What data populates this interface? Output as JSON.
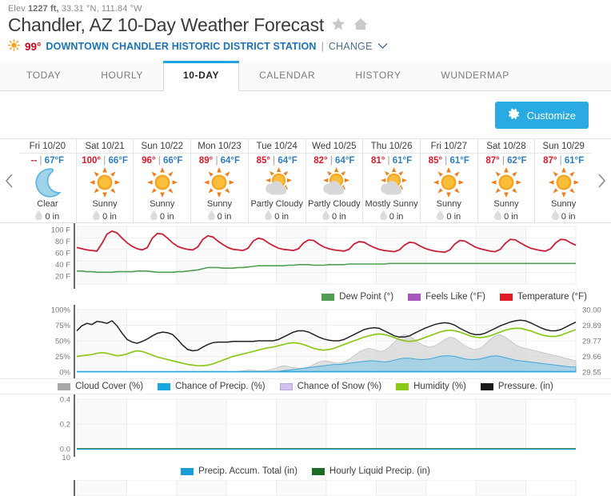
{
  "header": {
    "elev_prefix": "Elev",
    "elev_value": "1227 ft,",
    "coords": "33.31 °N, 111.84 °W",
    "title": "Chandler, AZ 10-Day Weather Forecast",
    "star_icon": "star-icon",
    "home_icon": "home-icon",
    "current_temp": "99°",
    "sun_icon": "sun-icon",
    "station": "DOWNTOWN CHANDLER HISTORIC DISTRICT STATION",
    "pipe": "|",
    "change_label": "CHANGE",
    "chevron_icon": "chevron-down-icon"
  },
  "tabs": [
    {
      "label": "TODAY",
      "active": false
    },
    {
      "label": "HOURLY",
      "active": false
    },
    {
      "label": "10-DAY",
      "active": true
    },
    {
      "label": "CALENDAR",
      "active": false
    },
    {
      "label": "HISTORY",
      "active": false
    },
    {
      "label": "WUNDERMAP",
      "active": false
    }
  ],
  "toolbar": {
    "customize_label": "Customize",
    "gear_icon": "gear-icon",
    "accent_color": "#29aae2"
  },
  "daystrip": {
    "prev_icon": "chevron-left-icon",
    "next_icon": "chevron-right-icon",
    "days": [
      {
        "name": "Fri 10/20",
        "high": "--",
        "low": "67°F",
        "cond": "Clear",
        "icon": "moon-icon",
        "precip": "0 in"
      },
      {
        "name": "Sat 10/21",
        "high": "100°",
        "low": "66°F",
        "cond": "Sunny",
        "icon": "sun-icon",
        "precip": "0 in"
      },
      {
        "name": "Sun 10/22",
        "high": "96°",
        "low": "66°F",
        "cond": "Sunny",
        "icon": "sun-icon",
        "precip": "0 in"
      },
      {
        "name": "Mon 10/23",
        "high": "89°",
        "low": "64°F",
        "cond": "Sunny",
        "icon": "sun-icon",
        "precip": "0 in"
      },
      {
        "name": "Tue 10/24",
        "high": "85°",
        "low": "64°F",
        "cond": "Partly Cloudy",
        "icon": "sun-cloud-icon",
        "precip": "0 in"
      },
      {
        "name": "Wed 10/25",
        "high": "82°",
        "low": "64°F",
        "cond": "Partly Cloudy",
        "icon": "sun-cloud-icon",
        "precip": "0 in"
      },
      {
        "name": "Thu 10/26",
        "high": "81°",
        "low": "61°F",
        "cond": "Mostly Sunny",
        "icon": "sun-cloud-icon",
        "precip": "0 in"
      },
      {
        "name": "Fri 10/27",
        "high": "85°",
        "low": "61°F",
        "cond": "Sunny",
        "icon": "sun-icon",
        "precip": "0 in"
      },
      {
        "name": "Sat 10/28",
        "high": "87°",
        "low": "62°F",
        "cond": "Sunny",
        "icon": "sun-icon",
        "precip": "0 in"
      },
      {
        "name": "Sun 10/29",
        "high": "87°",
        "low": "61°F",
        "cond": "Sunny",
        "icon": "sun-icon",
        "precip": "0 in"
      }
    ],
    "precip_drop_icon": "raindrop-icon"
  },
  "chart_data": [
    {
      "id": "temperature-chart",
      "type": "line",
      "title": "",
      "ylabel": "",
      "ylim": [
        10,
        108
      ],
      "yticks": [
        100,
        80,
        60,
        40,
        20
      ],
      "ytick_labels": [
        "100 F",
        "80 F",
        "60 F",
        "40 F",
        "20 F"
      ],
      "grid": true,
      "legend_position": "bottom-right",
      "x_days": 10,
      "series": [
        {
          "name": "Temperature (°F)",
          "color": "#cc1f37",
          "values": [
            72,
            70,
            68,
            67,
            66,
            79,
            95,
            100,
            97,
            88,
            80,
            74,
            70,
            68,
            72,
            88,
            96,
            95,
            88,
            80,
            74,
            71,
            69,
            68,
            73,
            86,
            92,
            90,
            83,
            77,
            72,
            69,
            68,
            67,
            71,
            83,
            88,
            86,
            80,
            75,
            71,
            69,
            68,
            67,
            70,
            80,
            85,
            84,
            78,
            73,
            70,
            68,
            67,
            66,
            69,
            78,
            82,
            81,
            76,
            72,
            69,
            67,
            66,
            65,
            68,
            76,
            81,
            80,
            75,
            71,
            68,
            66,
            65,
            64,
            68,
            78,
            84,
            83,
            78,
            73,
            70,
            68,
            66,
            65,
            69,
            79,
            86,
            85,
            80,
            75,
            71,
            69,
            67,
            66,
            70,
            80,
            86,
            85,
            80,
            76
          ]
        },
        {
          "name": "Dew Point (°)",
          "color": "#4f9e52",
          "values": [
            32,
            32,
            31,
            31,
            30,
            30,
            30,
            30,
            31,
            31,
            31,
            31,
            32,
            32,
            32,
            31,
            30,
            30,
            30,
            30,
            31,
            31,
            32,
            33,
            34,
            36,
            38,
            38,
            38,
            37,
            37,
            37,
            38,
            38,
            39,
            40,
            41,
            41,
            41,
            41,
            41,
            41,
            42,
            42,
            43,
            43,
            43,
            42,
            42,
            42,
            43,
            43,
            43,
            43,
            44,
            44,
            44,
            44,
            44,
            44,
            44,
            44,
            45,
            45,
            45,
            45,
            45,
            45,
            45,
            45,
            45,
            45,
            45,
            45,
            45,
            45,
            45,
            45,
            45,
            45,
            45,
            45,
            45,
            45,
            45,
            45,
            45,
            45,
            45,
            45,
            45,
            45,
            45,
            45,
            45,
            45,
            45,
            45,
            45,
            45
          ]
        },
        {
          "name": "Feels Like (°F)",
          "color": "#a855c0",
          "values": []
        }
      ]
    },
    {
      "id": "conditions-chart",
      "type": "area-line",
      "ylim_left": [
        0,
        100
      ],
      "yticks_left": [
        100,
        75,
        50,
        25,
        0
      ],
      "ytick_labels_left": [
        "100%",
        "75%",
        "50%",
        "25%",
        "0%"
      ],
      "ylim_right": [
        29.55,
        30.0
      ],
      "yticks_right": [
        30.0,
        29.89,
        29.77,
        29.66,
        29.55
      ],
      "ytick_labels_right": [
        "30.00",
        "29.89",
        "29.77",
        "29.66",
        "29.55"
      ],
      "grid": true,
      "legend_position": "bottom-center",
      "series": [
        {
          "name": "Pressure. (in)",
          "color": "#222222",
          "axis": "right",
          "values": [
            66,
            74,
            78,
            76,
            81,
            80,
            78,
            82,
            74,
            62,
            52,
            48,
            46,
            49,
            53,
            58,
            62,
            64,
            63,
            60,
            52,
            43,
            36,
            34,
            35,
            40,
            44,
            47,
            48,
            48,
            48,
            49,
            49,
            49,
            49,
            49,
            50,
            50,
            50,
            50,
            52,
            56,
            60,
            64,
            66,
            66,
            64,
            60,
            56,
            53,
            51,
            50,
            50,
            52,
            56,
            60,
            64,
            68,
            70,
            71,
            70,
            66,
            62,
            58,
            56,
            56,
            58,
            62,
            66,
            70,
            73,
            76,
            78,
            79,
            78,
            75,
            70,
            66,
            62,
            60,
            60,
            62,
            66,
            70,
            74,
            77,
            80,
            82,
            83,
            82,
            79,
            75,
            71,
            68,
            66,
            66,
            68,
            72,
            76,
            80
          ]
        },
        {
          "name": "Humidity (%)",
          "color": "#8bc919",
          "axis": "left",
          "values": [
            25,
            26,
            27,
            28,
            30,
            31,
            30,
            28,
            26,
            27,
            29,
            32,
            34,
            33,
            30,
            27,
            24,
            22,
            20,
            18,
            16,
            14,
            12,
            11,
            10,
            10,
            11,
            13,
            16,
            19,
            22,
            25,
            27,
            29,
            31,
            33,
            35,
            37,
            39,
            40,
            42,
            44,
            46,
            47,
            46,
            44,
            41,
            38,
            36,
            35,
            36,
            38,
            41,
            44,
            47,
            50,
            53,
            56,
            58,
            60,
            61,
            60,
            58,
            55,
            52,
            50,
            49,
            50,
            52,
            55,
            58,
            61,
            64,
            66,
            67,
            66,
            64,
            61,
            58,
            56,
            55,
            56,
            58,
            61,
            64,
            67,
            69,
            70,
            70,
            68,
            66,
            63,
            60,
            58,
            57,
            57,
            59,
            62,
            65,
            68
          ]
        },
        {
          "name": "Cloud Cover (%)",
          "color": "#b4b4b4",
          "axis": "left",
          "values": [
            0,
            0,
            0,
            0,
            0,
            0,
            0,
            0,
            0,
            0,
            0,
            0,
            0,
            0,
            0,
            0,
            0,
            0,
            0,
            0,
            0,
            0,
            0,
            0,
            0,
            0,
            0,
            0,
            0,
            0,
            0,
            0,
            1,
            2,
            3,
            3,
            2,
            2,
            3,
            5,
            8,
            10,
            9,
            7,
            6,
            6,
            8,
            12,
            16,
            18,
            17,
            15,
            14,
            16,
            20,
            26,
            32,
            36,
            38,
            36,
            33,
            34,
            40,
            48,
            56,
            60,
            58,
            52,
            46,
            42,
            40,
            42,
            46,
            52,
            56,
            54,
            48,
            42,
            38,
            36,
            38,
            44,
            52,
            58,
            60,
            56,
            50,
            44,
            40,
            38,
            36,
            34,
            32,
            30,
            28,
            26,
            24,
            22,
            20,
            18
          ]
        },
        {
          "name": "Chance of Precip. (%)",
          "color": "#29a9dd",
          "axis": "left",
          "values": [
            0,
            0,
            0,
            0,
            0,
            0,
            0,
            0,
            0,
            0,
            0,
            0,
            0,
            0,
            0,
            0,
            0,
            0,
            0,
            0,
            0,
            0,
            0,
            0,
            0,
            0,
            0,
            0,
            0,
            0,
            0,
            0,
            0,
            0,
            0,
            0,
            0,
            0,
            0,
            0,
            1,
            2,
            3,
            4,
            5,
            6,
            7,
            8,
            9,
            10,
            11,
            12,
            12,
            13,
            14,
            15,
            16,
            17,
            18,
            18,
            17,
            16,
            17,
            19,
            21,
            22,
            22,
            21,
            20,
            20,
            21,
            23,
            25,
            26,
            26,
            25,
            23,
            21,
            20,
            20,
            21,
            23,
            25,
            26,
            25,
            23,
            21,
            19,
            18,
            17,
            16,
            15,
            14,
            13,
            12,
            11,
            10,
            9,
            8,
            8
          ]
        },
        {
          "name": "Chance of Snow (%)",
          "color": "#c6b8e8",
          "axis": "left",
          "values": []
        }
      ]
    },
    {
      "id": "precipitation-chart",
      "type": "line",
      "ylim": [
        0,
        0.5
      ],
      "yticks": [
        0.4,
        0.2,
        0.0
      ],
      "ytick_labels": [
        "0.4",
        "0.2",
        "0.0"
      ],
      "grid": true,
      "legend_position": "bottom-center",
      "series": [
        {
          "name": "Precip. Accum. Total (in)",
          "color": "#1b9dd9",
          "values": []
        },
        {
          "name": "Hourly Liquid Precip. (in)",
          "color": "#1e6b28",
          "values": []
        }
      ]
    },
    {
      "id": "wind-chart",
      "type": "line",
      "yticks": [
        10
      ],
      "ytick_labels": [
        "10"
      ],
      "grid": true,
      "series": []
    }
  ],
  "legends": {
    "temperature": [
      {
        "label": "Dew Point (°)",
        "color": "#4f9e52"
      },
      {
        "label": "Feels Like (°F)",
        "color": "#a855c0"
      },
      {
        "label": "Temperature (°F)",
        "color": "#e01b24"
      }
    ],
    "conditions": [
      {
        "label": "Cloud Cover (%)",
        "color": "#a8a8a8"
      },
      {
        "label": "Chance of Precip. (%)",
        "color": "#18a8e0"
      },
      {
        "label": "Chance of Snow (%)",
        "color": "#d3c4ef"
      },
      {
        "label": "Humidity (%)",
        "color": "#8bc919"
      },
      {
        "label": "Pressure. (in)",
        "color": "#1a1a1a"
      }
    ],
    "precipitation": [
      {
        "label": "Precip. Accum. Total (in)",
        "color": "#1b9dd9"
      },
      {
        "label": "Hourly Liquid Precip. (in)",
        "color": "#1e6b28"
      }
    ]
  }
}
